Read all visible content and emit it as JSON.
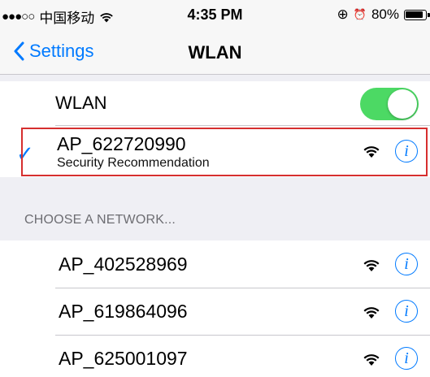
{
  "status_bar": {
    "signal": "●●●○○",
    "carrier": "中国移动",
    "wifi_glyph": "wifi-icon",
    "time": "4:35 PM",
    "lock_glyph": "⊕",
    "alarm_glyph": "⏰",
    "battery": "80%"
  },
  "nav": {
    "back_label": "Settings",
    "title": "WLAN"
  },
  "wlan_toggle": {
    "label": "WLAN",
    "on": true
  },
  "connected_network": {
    "name": "AP_622720990",
    "subtitle": "Security Recommendation",
    "checkmark": "✓",
    "info_glyph": "i"
  },
  "section_header": "CHOOSE A NETWORK...",
  "networks": [
    {
      "name": "AP_402528969",
      "info_glyph": "i"
    },
    {
      "name": "AP_619864096",
      "info_glyph": "i"
    },
    {
      "name": "AP_625001097",
      "info_glyph": "i"
    }
  ],
  "colors": {
    "accent": "#007aff",
    "toggle_on": "#4cd964",
    "highlight": "#d62f2f"
  }
}
